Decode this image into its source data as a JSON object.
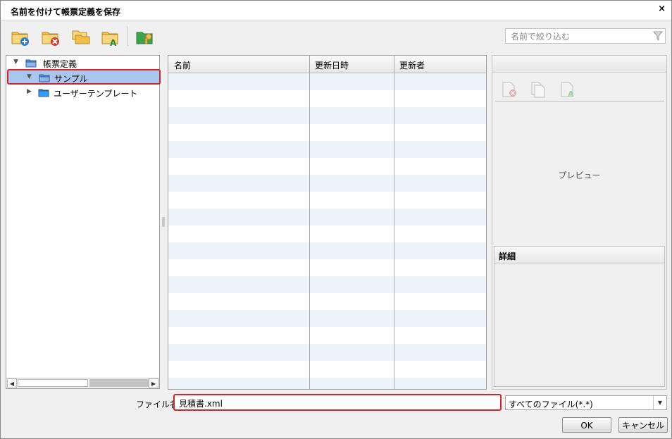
{
  "window": {
    "title": "名前を付けて帳票定義を保存",
    "close_glyph": "×"
  },
  "toolbar": {
    "buttons": [
      {
        "name": "new-folder-button",
        "icon": "folder-add-icon"
      },
      {
        "name": "delete-folder-button",
        "icon": "folder-delete-icon"
      },
      {
        "name": "copy-folder-button",
        "icon": "folder-copy-icon"
      },
      {
        "name": "rename-folder-button",
        "icon": "folder-rename-icon"
      },
      {
        "name": "permission-button",
        "icon": "folder-key-icon"
      }
    ],
    "filter_placeholder": "名前で絞り込む"
  },
  "tree": {
    "root": {
      "label": "帳票定義",
      "expanded_glyph": "▼"
    },
    "items": [
      {
        "label": "サンプル",
        "glyph": "▼",
        "selected": true
      },
      {
        "label": "ユーザーテンプレート",
        "glyph": "▶",
        "selected": false
      }
    ],
    "scroll_left": "◀",
    "scroll_right": "▶"
  },
  "file_list": {
    "columns": [
      "名前",
      "更新日時",
      "更新者"
    ],
    "rows": []
  },
  "preview": {
    "icons": [
      "file-delete-icon",
      "file-copy-icon",
      "file-rename-icon"
    ],
    "placeholder": "プレビュー",
    "detail_title": "詳細"
  },
  "footer": {
    "filename_label": "ファイル名",
    "filename_value": "見積書.xml",
    "filetype_value": "すべてのファイル(*.*)",
    "ok_label": "OK",
    "cancel_label": "キャンセル"
  },
  "colors": {
    "accent_red": "#d8232a",
    "selection_blue": "#a9c6ee",
    "stripe": "#edf3fa"
  }
}
